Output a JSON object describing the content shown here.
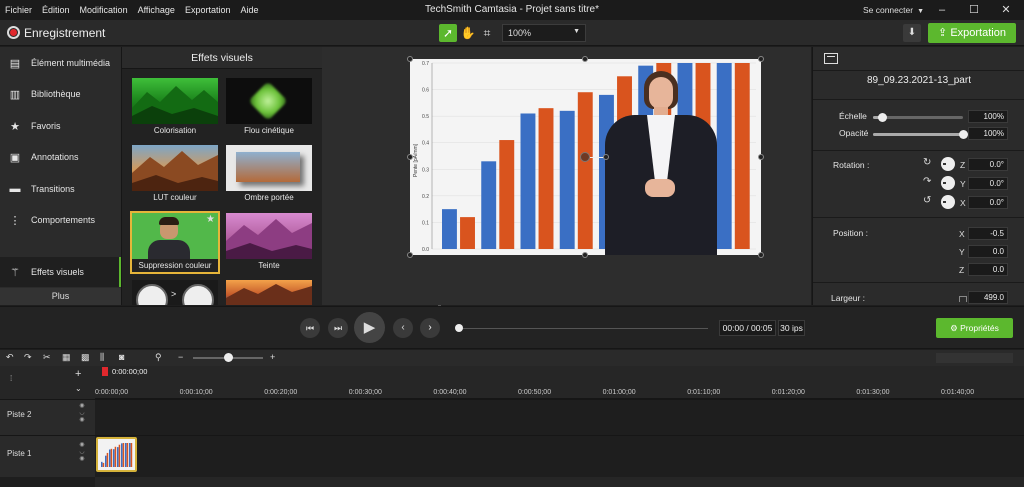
{
  "menu": [
    "Fichier",
    "Édition",
    "Modification",
    "Affichage",
    "Exportation",
    "Aide"
  ],
  "window": {
    "title": "TechSmith Camtasia - Projet sans titre*",
    "signin": "Se connecter",
    "minimize": "–",
    "maximize": "☐",
    "close": "✕"
  },
  "toolbar": {
    "record_label": "Enregistrement",
    "zoom": "100%",
    "export_label": "Exportation"
  },
  "nav": {
    "items": [
      {
        "label": "Élément multimédia",
        "icon": "media-icon"
      },
      {
        "label": "Bibliothèque",
        "icon": "library-icon"
      },
      {
        "label": "Favoris",
        "icon": "star-icon"
      },
      {
        "label": "Annotations",
        "icon": "annotation-icon"
      },
      {
        "label": "Transitions",
        "icon": "transition-icon"
      },
      {
        "label": "Comportements",
        "icon": "behavior-icon"
      },
      {
        "label": "Effets visuels",
        "icon": "magic-wand-icon"
      }
    ],
    "more": "Plus"
  },
  "library": {
    "title": "Effets visuels",
    "tiles": [
      {
        "label": "Colorisation"
      },
      {
        "label": "Flou cinétique"
      },
      {
        "label": "LUT couleur"
      },
      {
        "label": "Ombre portée"
      },
      {
        "label": "Suppression couleur"
      },
      {
        "label": "Teinte"
      },
      {
        "label": ""
      },
      {
        "label": ""
      }
    ]
  },
  "canvas": {
    "chart_data": {
      "type": "bar",
      "ylabel": "Pente [pA/mm]",
      "ylim": [
        0.0,
        0.7
      ],
      "yticks": [
        "0.0",
        "0.1",
        "0.2",
        "0.3",
        "0.4",
        "0.5",
        "0.6",
        "0.7"
      ],
      "series": [
        {
          "color": "#3a6fc4",
          "values": [
            0.15,
            0.33,
            0.51,
            0.52,
            0.58,
            0.69,
            0.7,
            0.7
          ]
        },
        {
          "color": "#d9541e",
          "values": [
            0.12,
            0.41,
            0.53,
            0.59,
            0.65,
            0.7,
            0.7,
            0.7
          ]
        }
      ]
    }
  },
  "properties": {
    "clip_name": "89_09.23.2021-13_part",
    "scale_label": "Échelle",
    "scale_value": "100%",
    "scale_level": 0.1,
    "opacity_label": "Opacité",
    "opacity_value": "100%",
    "opacity_level": 1.0,
    "rotation_label": "Rotation :",
    "rot_z_label": "Z",
    "rot_z": "0.0°",
    "rot_y_label": "Y",
    "rot_y": "0.0°",
    "rot_x_label": "X",
    "rot_x": "0.0°",
    "position_label": "Position :",
    "pos_x_label": "X",
    "pos_x": "-0.5",
    "pos_y_label": "Y",
    "pos_y": "0.0",
    "pos_z_label": "Z",
    "pos_z": "0.0",
    "width_label": "Largeur :",
    "width_value": "499.0"
  },
  "player": {
    "timecode": "00:00 / 00:05",
    "fps": "30 ips",
    "properties_button": "Propriétés",
    "progress": 0.0
  },
  "timeline": {
    "playhead": "0:00:00;00",
    "ticks": [
      "0:00:00;00",
      "0:00:10;00",
      "0:00:20;00",
      "0:00:30;00",
      "0:00:40;00",
      "0:00:50;00",
      "0:01:00;00",
      "0:01:10;00",
      "0:01:20;00",
      "0:01:30;00",
      "0:01:40;00"
    ],
    "tracks": [
      "Piste 2",
      "Piste 1"
    ]
  }
}
